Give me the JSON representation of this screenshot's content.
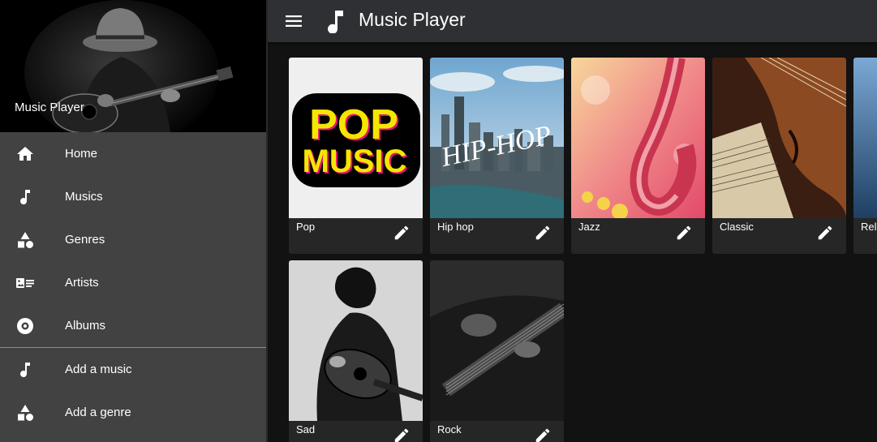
{
  "app": {
    "title": "Music Player"
  },
  "sidebar": {
    "header_title": "Music Player",
    "items": [
      {
        "label": "Home",
        "icon": "home-icon"
      },
      {
        "label": "Musics",
        "icon": "music-note-icon"
      },
      {
        "label": "Genres",
        "icon": "shapes-icon"
      },
      {
        "label": "Artists",
        "icon": "artist-card-icon"
      },
      {
        "label": "Albums",
        "icon": "album-icon"
      }
    ],
    "actions": [
      {
        "label": "Add a music",
        "icon": "music-note-icon"
      },
      {
        "label": "Add a genre",
        "icon": "shapes-icon"
      }
    ]
  },
  "genres": [
    {
      "label": "Pop",
      "image_text": [
        "POP",
        "MUSIC"
      ]
    },
    {
      "label": "Hip hop",
      "image_text": [
        "HIP-HOP"
      ]
    },
    {
      "label": "Jazz"
    },
    {
      "label": "Classic"
    },
    {
      "label": "Rel"
    },
    {
      "label": "Sad"
    },
    {
      "label": "Rock"
    }
  ],
  "colors": {
    "accent_pop_yellow": "#f5e600",
    "accent_pop_magenta": "#e0147a",
    "topbar": "#2f3033",
    "sidebar": "#424242"
  }
}
